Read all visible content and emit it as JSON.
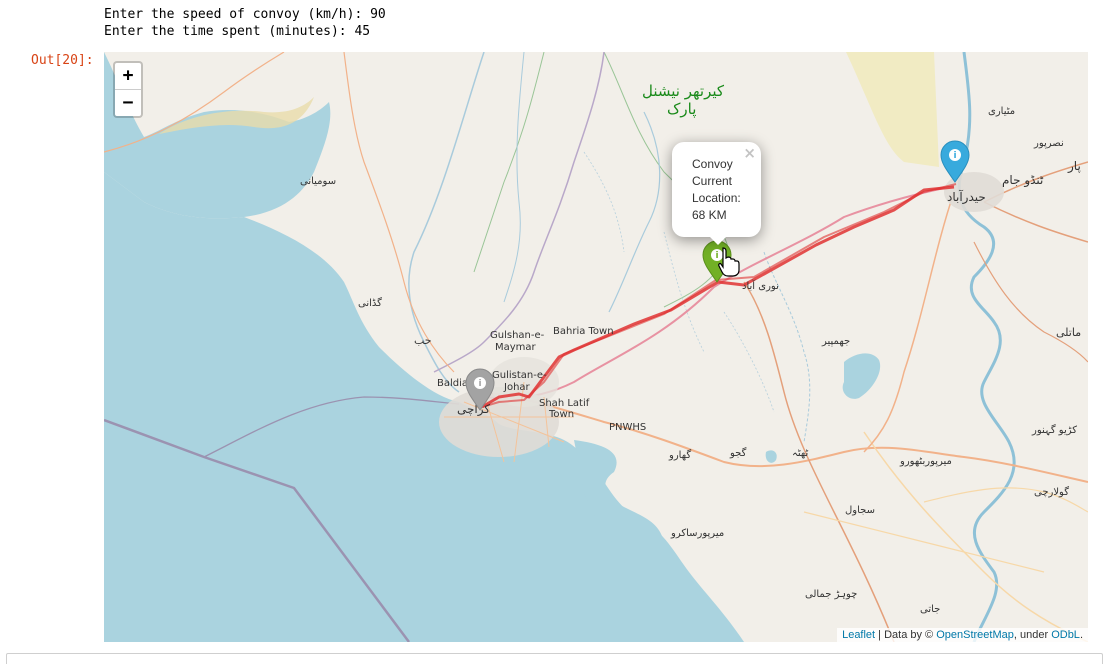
{
  "stdout": {
    "line1": "Enter the speed of convoy (km/h): 90",
    "line2": "Enter the time spent (minutes): 45"
  },
  "output_prompt": "Out[20]:",
  "zoom": {
    "zoom_in": "+",
    "zoom_out": "−"
  },
  "popup": {
    "line1": "Convoy",
    "line2": "Current",
    "line3": "Location:",
    "line4": "68 KM",
    "close": "×"
  },
  "labels": {
    "park1": "کیرتھر نیشنل",
    "park2": "پارک",
    "matiari": "مٹیاری",
    "nasarpur": "نصرپور",
    "tando_jam": "ٹنڈو جام",
    "hyderabad": "حیدرآباد",
    "par": "پار",
    "sonmiani": "سومیانی",
    "gaddani": "گڈانی",
    "hub": "حب",
    "gulshan1": "Gulshan-e-",
    "gulshan2": "Maymar",
    "bahria": "Bahria Town",
    "gulistan1": "Gulistan-e-",
    "gulistan2": "Johar",
    "baldia": "Baldia",
    "karachi": "کراچی",
    "shah_latif1": "Shah Latif",
    "shah_latif2": "Town",
    "pnwhs": "PNWHS",
    "noori_abad": "نوری آباد",
    "jhimpir": "جھمپیر",
    "matli": "ماتلی",
    "thatta": "ٹھٹہ",
    "gujjo": "گجو",
    "gharo": "گھارو",
    "mirpur_bathoro": "میرپوربٹھورو",
    "kario_ganhwar": "کڑیو گہنور",
    "golarchi": "گولارچی",
    "sujawal": "سجاول",
    "mirpur_sakro": "میرپورساکرو",
    "chohar_jamali": "چوہڑ جمالی",
    "jati": "جاتی"
  },
  "attribution": {
    "leaflet": "Leaflet",
    "sep": " | Data by © ",
    "osm": "OpenStreetMap",
    "under": ", under ",
    "odbl": "ODbL",
    "end": "."
  },
  "colors": {
    "sea": "#aad3df",
    "land": "#f2efe9",
    "route": "#e03232",
    "marker_green": "#72b026",
    "marker_blue": "#38aadd",
    "marker_gray": "#a3a3a3"
  },
  "markers": [
    {
      "name": "Hyderabad",
      "icon": "info-sign-icon",
      "color": "blue"
    },
    {
      "name": "Convoy",
      "icon": "info-sign-icon",
      "color": "green"
    },
    {
      "name": "Karachi",
      "icon": "info-sign-icon",
      "color": "gray"
    }
  ]
}
